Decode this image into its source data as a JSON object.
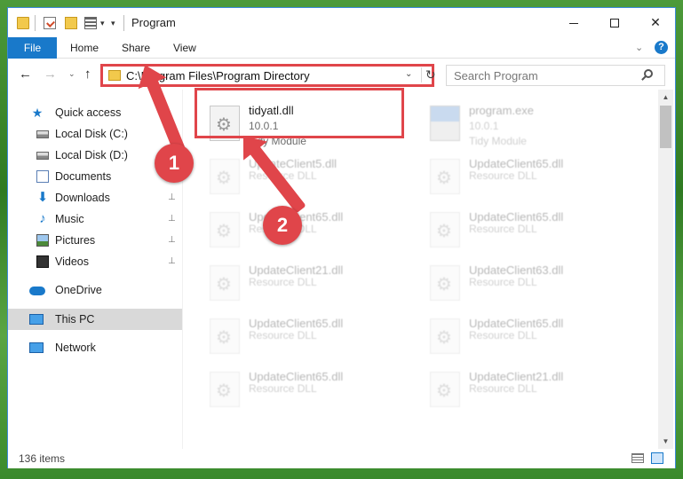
{
  "window": {
    "title": "Program",
    "controls": {
      "minimize": "",
      "maximize": "",
      "close": "✕"
    }
  },
  "ribbon": {
    "tabs": [
      "File",
      "Home",
      "Share",
      "View"
    ],
    "collapse_icon": "chevron-down-icon",
    "help_label": "?"
  },
  "address": {
    "path": "C:\\Program Files\\Program Directory",
    "dropdown_glyph": "⌄",
    "refresh_glyph": "↻",
    "nav": {
      "back": "←",
      "forward": "→",
      "recent": "⌄",
      "up": "↑"
    }
  },
  "search": {
    "placeholder": "Search Program"
  },
  "sidebar": {
    "items": [
      {
        "label": "Quick access",
        "icon": "star-icon",
        "pinned": false
      },
      {
        "label": "Local Disk (C:)",
        "icon": "disk-icon",
        "pinned": true
      },
      {
        "label": "Local Disk (D:)",
        "icon": "disk-icon",
        "pinned": false
      },
      {
        "label": "Documents",
        "icon": "documents-icon",
        "pinned": true
      },
      {
        "label": "Downloads",
        "icon": "download-icon",
        "pinned": true
      },
      {
        "label": "Music",
        "icon": "music-icon",
        "pinned": true
      },
      {
        "label": "Pictures",
        "icon": "pictures-icon",
        "pinned": true
      },
      {
        "label": "Videos",
        "icon": "videos-icon",
        "pinned": true
      },
      {
        "label": "OneDrive",
        "icon": "cloud-icon",
        "pinned": false
      },
      {
        "label": "This PC",
        "icon": "pc-icon",
        "pinned": false,
        "selected": true
      },
      {
        "label": "Network",
        "icon": "network-icon",
        "pinned": false
      }
    ],
    "pin_glyph": "📌"
  },
  "files": [
    {
      "name": "tidyatl.dll",
      "version": "10.0.1",
      "description": "Tidy Module",
      "highlighted": true
    },
    {
      "name": "program.exe",
      "version": "10.0.1",
      "description": "Tidy Module",
      "faded": true
    },
    {
      "name": "UpdateClient5.dll",
      "version": "",
      "description": "Resource DLL",
      "faded": true
    },
    {
      "name": "UpdateClient65.dll",
      "version": "",
      "description": "Resource DLL",
      "faded": true
    },
    {
      "name": "UpdateClient65.dll",
      "version": "",
      "description": "Resource DLL",
      "faded": true
    },
    {
      "name": "UpdateClient65.dll",
      "version": "",
      "description": "Resource DLL",
      "faded": true
    },
    {
      "name": "UpdateClient21.dll",
      "version": "",
      "description": "Resource DLL",
      "faded": true
    },
    {
      "name": "UpdateClient63.dll",
      "version": "",
      "description": "Resource DLL",
      "faded": true
    },
    {
      "name": "UpdateClient65.dll",
      "version": "",
      "description": "Resource DLL",
      "faded": true
    },
    {
      "name": "UpdateClient65.dll",
      "version": "",
      "description": "Resource DLL",
      "faded": true
    },
    {
      "name": "UpdateClient65.dll",
      "version": "",
      "description": "Resource DLL",
      "faded": true
    },
    {
      "name": "UpdateClient21.dll",
      "version": "",
      "description": "Resource DLL",
      "faded": true
    }
  ],
  "status": {
    "item_count": "136 items"
  },
  "annotations": {
    "step1": "1",
    "step2": "2"
  },
  "colors": {
    "accent": "#1979ca",
    "highlight": "#e0454a",
    "selected_bg": "#d9d9d9"
  },
  "scrollbar": {
    "up": "▲",
    "down": "▼"
  }
}
